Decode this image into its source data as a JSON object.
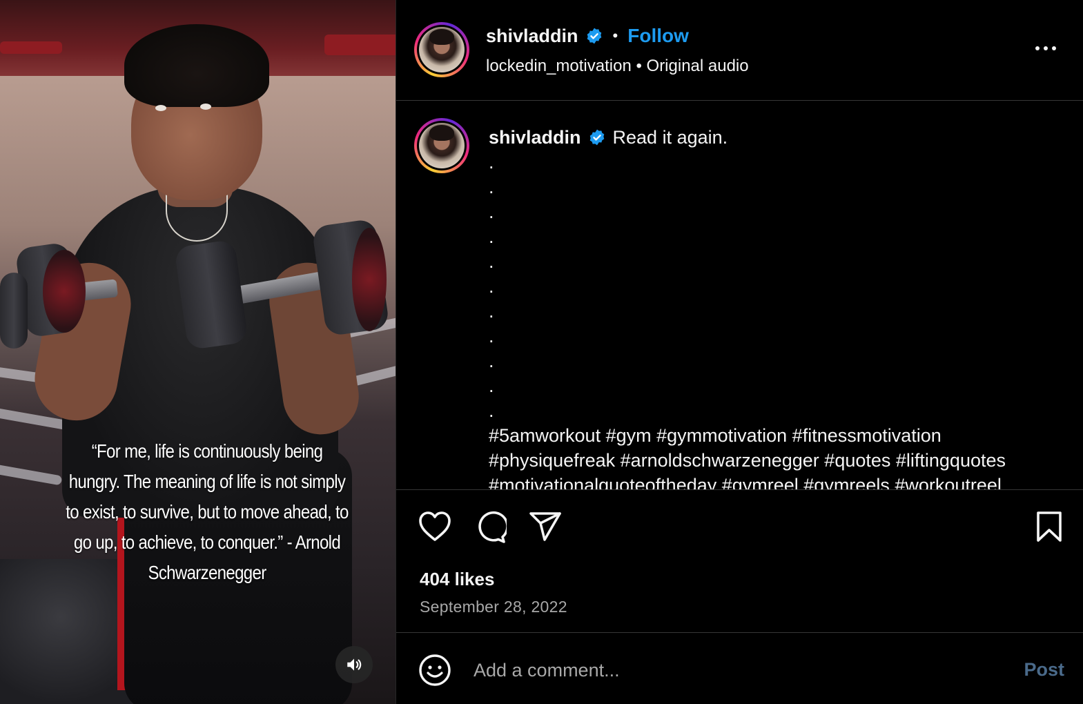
{
  "video": {
    "quote": "“For me, life is continuously being hungry. The meaning of life is not simply to exist, to survive, but to move ahead, to go up, to achieve, to conquer.” - Arnold Schwarzenegger",
    "audio_icon": "speaker-on-icon"
  },
  "header": {
    "username": "shivladdin",
    "separator": "•",
    "follow_label": "Follow",
    "audio_source": "lockedin_motivation • Original audio",
    "more_icon": "more-options-icon"
  },
  "caption": {
    "username": "shivladdin",
    "text": "Read it again.",
    "dots": [
      ".",
      ".",
      ".",
      ".",
      ".",
      ".",
      ".",
      ".",
      ".",
      ".",
      "."
    ],
    "hashtags_line1": "#5amworkout #gym #gymmotivation #fitnessmotivation",
    "hashtags_line2": "#physiquefreak #arnoldschwarzenegger #quotes #liftingquotes",
    "hashtags_line3": "#motivationalquoteoftheday #gymreel #gymreels #workoutreel"
  },
  "actions": {
    "like_icon": "heart-icon",
    "comment_icon": "comment-icon",
    "share_icon": "send-icon",
    "save_icon": "bookmark-icon",
    "likes": "404 likes",
    "date": "September 28, 2022"
  },
  "comment": {
    "emoji_icon": "emoji-icon",
    "placeholder": "Add a comment...",
    "post_label": "Post"
  },
  "colors": {
    "accent": "#1d9bf0",
    "verified": "#1d9bf0",
    "muted": "#a8a8a8",
    "post_disabled": "#4a6a8a"
  }
}
